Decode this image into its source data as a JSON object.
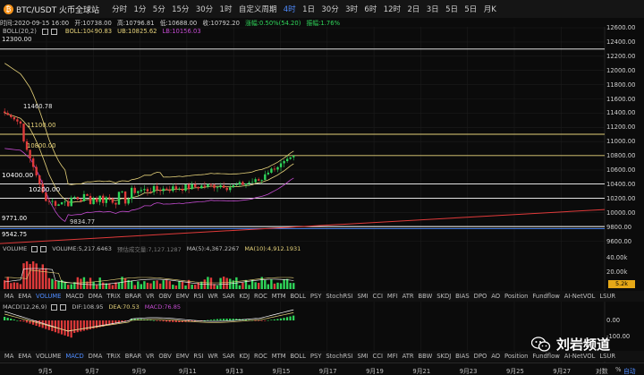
{
  "header": {
    "symbol": "BTC/USDT 火币全球站",
    "timeframes": [
      "分时",
      "1分",
      "5分",
      "15分",
      "30分",
      "1时",
      "自定义周期",
      "4时",
      "1日",
      "30分",
      "3时",
      "6时",
      "12时",
      "2日",
      "3日",
      "5日",
      "5日",
      "月K"
    ],
    "active_index": 7
  },
  "info": {
    "time": "时间:2020-09-15 16:00",
    "open": "开:10738.00",
    "high": "高:10796.81",
    "low": "低:10688.00",
    "close": "收:10792.20",
    "change": "涨幅:0.50%(54.20)",
    "amplitude": "振幅:1.76%"
  },
  "boll": {
    "label": "BOLL(20,2)",
    "mid": "BOLL:10490.83",
    "ub": "UB:10825.62",
    "lb": "LB:10156.03",
    "mid_color": "#e6d27a",
    "ub_color": "#e6d27a",
    "lb_color": "#c44bd1"
  },
  "price_axis": [
    "12600.00",
    "12400.00",
    "12200.00",
    "12000.00",
    "11800.00",
    "11600.00",
    "11400.00",
    "11200.00",
    "11000.00",
    "10800.00",
    "10600.00",
    "10400.00",
    "10200.00",
    "10000.00",
    "9800.00",
    "9600.00"
  ],
  "annotations": {
    "a12300": "12300.00",
    "a11460": "11460.78",
    "a11100": "11100.00",
    "a10800": "10800.00",
    "a10400": "10400.00",
    "a10200": "10200.00",
    "a9834": "9834.77",
    "a9771": "9771.00",
    "a9542": "9542.75"
  },
  "volume": {
    "label": "VOLUME",
    "value": "VOLUME:5,217.6463",
    "amount": "预估成交量:7,127.1287",
    "ma5": "MA(5):4,367.2267",
    "ma10": "MA(10):4,912.1931",
    "axis": [
      "40.00k",
      "20.00k"
    ],
    "current": "5.2k"
  },
  "indicators_row": [
    "MA",
    "EMA",
    "VOLUME",
    "MACD",
    "DMA",
    "TRIX",
    "BRAR",
    "VR",
    "OBV",
    "EMV",
    "RSI",
    "WR",
    "SAR",
    "KDJ",
    "ROC",
    "MTM",
    "BOLL",
    "PSY",
    "StochRSI",
    "SMI",
    "CCI",
    "MFI",
    "ATR",
    "BBW",
    "SKDJ",
    "BIAS",
    "DPO",
    "AO",
    "Position",
    "Fundflow",
    "AI-NetVOL",
    "LSUR"
  ],
  "indicators_row2": [
    "MA",
    "EMA",
    "VOLUME",
    "MACD",
    "DMA",
    "TRIX",
    "BRAR",
    "VR",
    "OBV",
    "EMV",
    "RSI",
    "WR",
    "SAR",
    "KDJ",
    "ROC",
    "MTM",
    "BOLL",
    "PSY",
    "StochRSI",
    "SMI",
    "CCI",
    "MFI",
    "ATR",
    "BBW",
    "SKDJ",
    "BIAS",
    "DPO",
    "AO",
    "Position",
    "Fundflow",
    "AI-NetVOL",
    "LSUR"
  ],
  "macd": {
    "label": "MACD(12,26,9)",
    "dif": "DIF:108.95",
    "dea": "DEA:70.53",
    "macd": "MACD:76.85",
    "axis": [
      "0.00",
      "-100.00"
    ]
  },
  "dates": [
    "9月5",
    "9月7",
    "9月9",
    "9月11",
    "9月13",
    "9月15",
    "9月17",
    "9月19",
    "9月21",
    "9月23",
    "9月25",
    "9月27"
  ],
  "bottom_right": {
    "scale": "对数",
    "pct": "%",
    "auto": "自动"
  },
  "watermark": "刘岩频道",
  "colors": {
    "up": "#2fd65a",
    "down": "#e03a3a",
    "accent": "#4f8cff"
  }
}
